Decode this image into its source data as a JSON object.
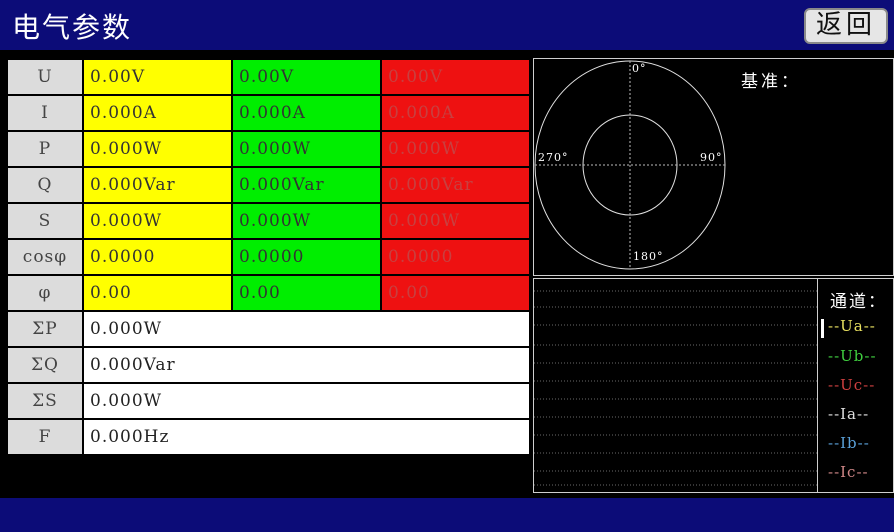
{
  "header": {
    "title": "电气参数",
    "back_label": "返回"
  },
  "phase_rows": [
    {
      "label": "U",
      "a": "0.00V",
      "b": "0.00V",
      "c": "0.00V"
    },
    {
      "label": "I",
      "a": "0.000A",
      "b": "0.000A",
      "c": "0.000A"
    },
    {
      "label": "P",
      "a": "0.000W",
      "b": "0.000W",
      "c": "0.000W"
    },
    {
      "label": "Q",
      "a": "0.000Var",
      "b": "0.000Var",
      "c": "0.000Var"
    },
    {
      "label": "S",
      "a": "0.000W",
      "b": "0.000W",
      "c": "0.000W"
    },
    {
      "label": "cosφ",
      "a": "0.0000",
      "b": "0.0000",
      "c": "0.0000"
    },
    {
      "label": "φ",
      "a": "0.00",
      "b": "0.00",
      "c": "0.00"
    }
  ],
  "total_rows": [
    {
      "label": "ΣP",
      "value": "0.000W"
    },
    {
      "label": "ΣQ",
      "value": "0.000Var"
    },
    {
      "label": "ΣS",
      "value": "0.000W"
    },
    {
      "label": "F",
      "value": "0.000Hz"
    }
  ],
  "phasor": {
    "reference_label": "基准：",
    "deg_0": "0°",
    "deg_90": "90°",
    "deg_180": "180°",
    "deg_270": "270°"
  },
  "waveform": {
    "channel_title": "通道：",
    "channels": [
      {
        "label": "--Ua--",
        "color": "#e8e060"
      },
      {
        "label": "--Ub--",
        "color": "#40d040"
      },
      {
        "label": "--Uc--",
        "color": "#d04040"
      },
      {
        "label": "--Ia--",
        "color": "#e0e0e0"
      },
      {
        "label": "--Ib--",
        "color": "#5aa0d8"
      },
      {
        "label": "--Ic--",
        "color": "#d08888"
      }
    ]
  },
  "colors": {
    "phase_a": "#ffff00",
    "phase_b": "#00ee00",
    "phase_c": "#ee1111",
    "title_bar": "#0c0c78",
    "background": "#000000"
  }
}
